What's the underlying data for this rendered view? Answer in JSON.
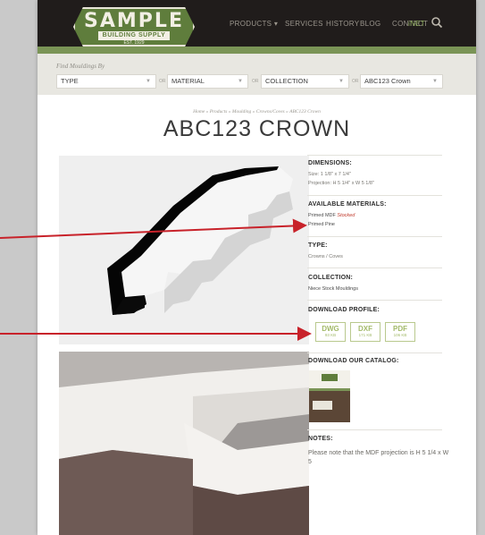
{
  "header": {
    "logo": {
      "title": "SAMPLE",
      "subtitle": "BUILDING SUPPLY",
      "est": "EST. 1929"
    },
    "nav": [
      {
        "label": "PRODUCTS ▾"
      },
      {
        "label": "SERVICES"
      },
      {
        "label": "HISTORY"
      },
      {
        "label": "BLOG"
      },
      {
        "label": "CONTACT"
      },
      {
        "label": "iNET"
      }
    ],
    "search_icon": "search-icon"
  },
  "filters": {
    "label": "Find Mouldings By",
    "selects": [
      {
        "value": "TYPE"
      },
      {
        "value": "MATERIAL"
      },
      {
        "value": "COLLECTION"
      },
      {
        "value": "ABC123 Crown"
      }
    ],
    "or_label": "OR"
  },
  "breadcrumb": "Home » Products » Moulding » Crowns/Coves » ABC123 Crown",
  "title": "ABC123 CROWN",
  "details": {
    "dimensions": {
      "heading": "DIMENSIONS:",
      "size": "Size: 1 1/8\" x 7 1/4\"",
      "projection": "Projection: H 5 1/4\" x W 5 1/8\""
    },
    "materials": {
      "heading": "AVAILABLE MATERIALS:",
      "item1": "Primed MDF",
      "item1_badge": "Stocked",
      "item2": "Primed Pine"
    },
    "type": {
      "heading": "TYPE:",
      "value": "Crowns / Coves"
    },
    "collection": {
      "heading": "COLLECTION:",
      "value": "Niece Stock Mouldings"
    },
    "download": {
      "heading": "DOWNLOAD PROFILE:",
      "files": [
        {
          "format": "DWG",
          "size": "93 KB"
        },
        {
          "format": "DXF",
          "size": "171 KB"
        },
        {
          "format": "PDF",
          "size": "106 KB"
        }
      ]
    },
    "catalog": {
      "heading": "DOWNLOAD OUR CATALOG:"
    },
    "notes": {
      "heading": "NOTES:",
      "text": "Please note that the MDF projection is H 5 1/4 x W 5"
    }
  },
  "colors": {
    "header_bg": "#201c1b",
    "accent_green": "#7a9456",
    "stock_red": "#c0392b",
    "arrow_red": "#c8222a"
  }
}
